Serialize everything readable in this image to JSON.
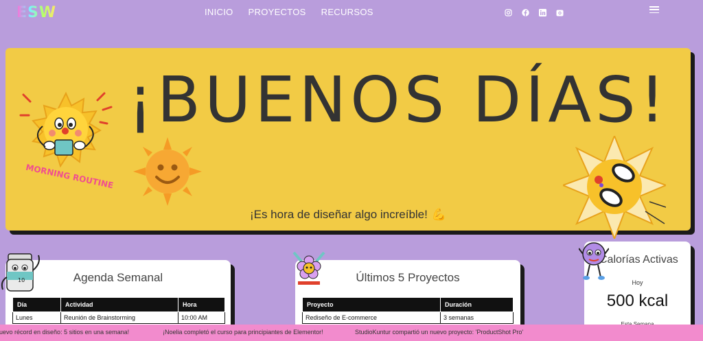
{
  "header": {
    "logo": "ESW",
    "nav": [
      "INICIO",
      "PROYECTOS",
      "RECURSOS"
    ],
    "social": [
      "instagram-icon",
      "facebook-icon",
      "linkedin-icon",
      "camera-icon"
    ],
    "menu_icon": "hamburger-icon"
  },
  "banner": {
    "title": "¡BUENOS DÍAS!",
    "subtitle": "¡Es hora de diseñar algo increíble!",
    "subtitle_emoji": "💪",
    "sticker_text": "MORNING ROUTINE"
  },
  "agenda": {
    "title": "Agenda Semanal",
    "columns": [
      "Día",
      "Actividad",
      "Hora"
    ],
    "rows": [
      [
        "Lunes",
        "Reunión de Brainstorming",
        "10:00 AM"
      ]
    ]
  },
  "projects": {
    "title": "Últimos 5 Proyectos",
    "columns": [
      "Proyecto",
      "Duración"
    ],
    "rows": [
      [
        "Rediseño de E-commerce",
        "3 semanas"
      ]
    ]
  },
  "calories": {
    "title": "Calorías Activas",
    "today_label": "Hoy",
    "today_value": "500 kcal",
    "week_label": "Esta Semana"
  },
  "ticker": [
    "nuevo récord en diseño: 5 sitios en una semana!",
    "¡Noelia completó el curso para principiantes de Elementor!",
    "StudioKuntur compartió un nuevo proyecto: 'ProductShot Pro'"
  ],
  "colors": {
    "background": "#b99ddc",
    "banner": "#f2cb45",
    "ticker": "#f28bcd",
    "card": "#ffffff",
    "table_header": "#111111"
  }
}
